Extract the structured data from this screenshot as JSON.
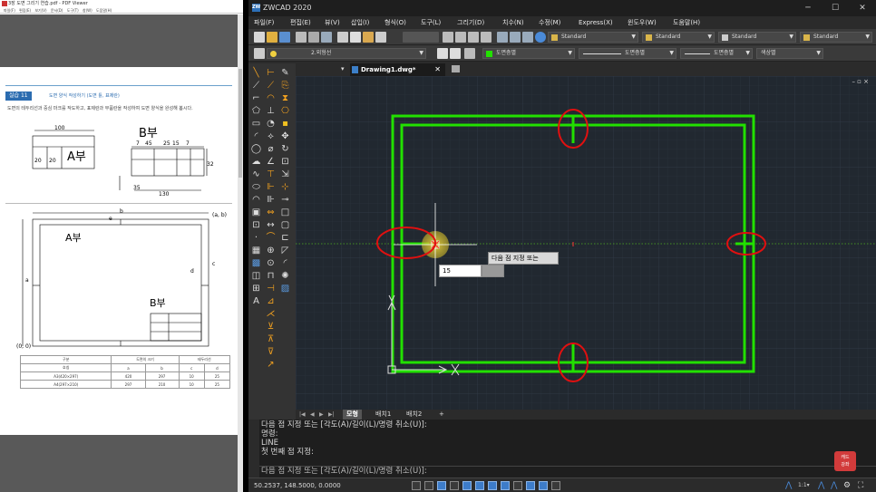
{
  "pdf_viewer": {
    "window_title": "3장 도면 그리기 연습.pdf - PDF Viewer",
    "menu": [
      "파일(F)",
      "편집(E)",
      "보기(V)",
      "문서(D)",
      "도구(T)",
      "창(W)",
      "도움말(H)"
    ],
    "exercise_badge": "실습 11",
    "exercise_title": "도면 양식 작성하기 (도면 틀, 표제란)",
    "exercise_text": "도면의 테두리선과 중심 마크를 작도하고, 표제란과 부품란을 작성하여 도면 양식을 완성해 봅시다.",
    "top_drawing": {
      "dim_100": "100",
      "dim_20a": "20",
      "dim_20b": "20",
      "label_a": "A부",
      "label_b": "B부",
      "dim_7a": "7",
      "dim_45": "45",
      "dim_25": "25",
      "dim_15": "15",
      "dim_7b": "7",
      "dim_35": "35",
      "dim_130": "130",
      "dim_32": "32"
    },
    "sheet": {
      "label_a": "A부",
      "label_b": "B부",
      "corner_ab": "(a, b)",
      "corner_00": "(0, 0)",
      "dim_a": "a",
      "dim_b": "b",
      "dim_c": "c",
      "dim_d": "d",
      "dim_e": "e"
    },
    "table": {
      "headers": [
        "구분",
        "도면의 크기",
        "",
        "테두리선",
        ""
      ],
      "subheader": [
        "호칭",
        "a",
        "b",
        "c",
        "d"
      ],
      "rows": [
        [
          "A3(420×297)",
          "420",
          "297",
          "10",
          "25"
        ],
        [
          "A4(297×210)",
          "297",
          "210",
          "10",
          "25"
        ]
      ]
    }
  },
  "cad": {
    "title": "ZWCAD 2020",
    "logo_text": "ZW",
    "window_buttons": [
      "─",
      "☐",
      "✕"
    ],
    "menu": [
      "파일(F)",
      "편집(E)",
      "뷰(V)",
      "삽입(I)",
      "형식(O)",
      "도구(L)",
      "그리기(D)",
      "치수(N)",
      "수정(M)",
      "Express(X)",
      "윈도우(W)",
      "도움말(H)"
    ],
    "styles": {
      "text_style": "Standard",
      "dim_style": "Standard",
      "table_style": "Standard",
      "multileader_style": "Standard"
    },
    "layers": {
      "current_layer": "2.외형선",
      "color": "도면층별",
      "linetype": "도면층별",
      "lineweight": "도면층별",
      "plot_style": "색상별"
    },
    "doc_tab": "Drawing1.dwg*",
    "doc_tab_close": "✕",
    "canvas_controls": "– ▫ ×",
    "tooltip": "다음 점 지정 또는",
    "length_input": "15",
    "layout_nav": [
      "|◀",
      "◀",
      "▶",
      "▶|"
    ],
    "layout_tabs": [
      "모형",
      "배치1",
      "배치2",
      "+"
    ],
    "command_history": [
      "다음 점 지정 또는 [각도(A)/길이(L)/명령 취소(U)]:",
      "명령:",
      "LINE",
      "첫 번째 점 지정:"
    ],
    "command_prompt": "다음 점 지정 또는 [각도(A)/길이(L)/명령 취소(U)]:",
    "brand_badge": [
      "캐드",
      "강좌"
    ],
    "coordinates": "50.2537, 148.5000, 0.0000",
    "colors": {
      "rectangle": "#22e000",
      "highlight_circle": "#e01010",
      "canvas_bg": "#212830",
      "cursor_glow": "#d4c23a"
    }
  }
}
